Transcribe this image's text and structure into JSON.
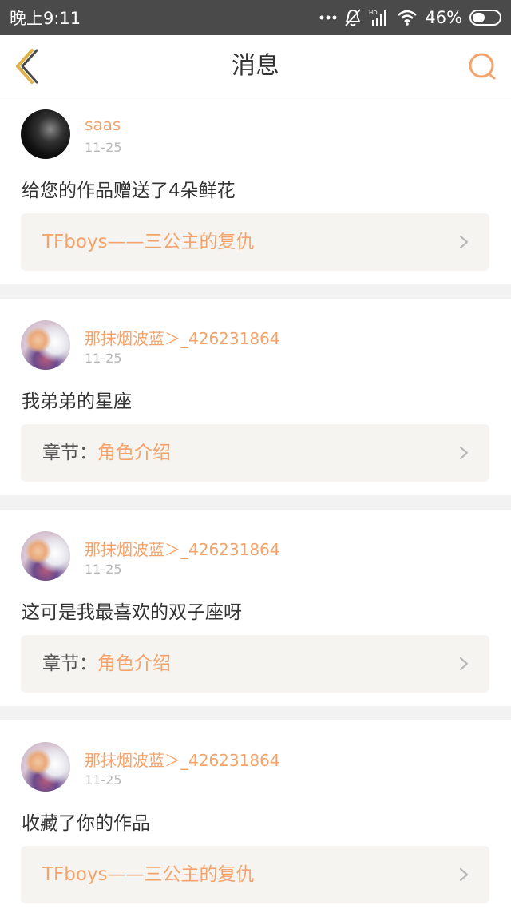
{
  "status_bar": {
    "time": "晚上9:11",
    "battery": "46%",
    "battery_level": 0.46
  },
  "nav": {
    "title": "消息",
    "back_icon": "chevron-left-icon",
    "search_icon": "search-icon"
  },
  "colors": {
    "accent": "#f5a36b",
    "back_icon": "#e0b24a"
  },
  "messages": [
    {
      "user": "saas",
      "date": "11-25",
      "text": "给您的作品赠送了4朵鲜花",
      "ref_label": "",
      "ref_title": "TFboys——三公主的复仇"
    },
    {
      "user": "那抹烟波蓝＞_426231864",
      "date": "11-25",
      "text": "我弟弟的星座",
      "ref_label": "章节：",
      "ref_title": "角色介绍"
    },
    {
      "user": "那抹烟波蓝＞_426231864",
      "date": "11-25",
      "text": "这可是我最喜欢的双子座呀",
      "ref_label": "章节：",
      "ref_title": "角色介绍"
    },
    {
      "user": "那抹烟波蓝＞_426231864",
      "date": "11-25",
      "text": "收藏了你的作品",
      "ref_label": "",
      "ref_title": "TFboys——三公主的复仇"
    }
  ]
}
